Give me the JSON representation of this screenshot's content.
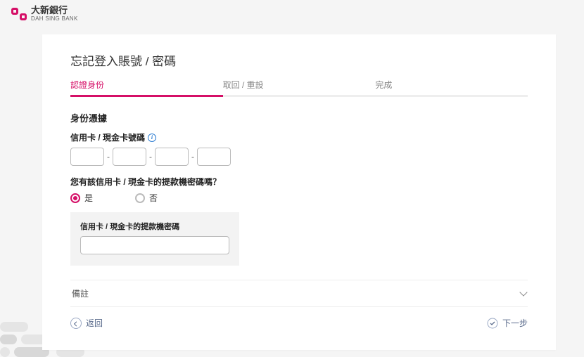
{
  "branding": {
    "name_zh": "大新銀行",
    "name_en": "DAH SING BANK"
  },
  "page": {
    "title": "忘記登入賬號 / 密碼"
  },
  "stepper": {
    "steps": [
      {
        "label": "認證身份",
        "active": true
      },
      {
        "label": "取回 / 重設",
        "active": false
      },
      {
        "label": "完成",
        "active": false
      }
    ]
  },
  "identity": {
    "section_title": "身份憑據",
    "card_label": "信用卡 / 現金卡號碼",
    "card_segments": [
      "",
      "",
      "",
      ""
    ],
    "atm_pin_question": "您有該信用卡 / 現金卡的提款機密碼嗎？",
    "radio_yes": "是",
    "radio_no": "否",
    "radio_selected": "yes",
    "pin_label": "信用卡 / 現金卡的提款機密碼",
    "pin_value": ""
  },
  "remarks": {
    "label": "備註"
  },
  "nav": {
    "back": "返回",
    "next": "下一步"
  }
}
